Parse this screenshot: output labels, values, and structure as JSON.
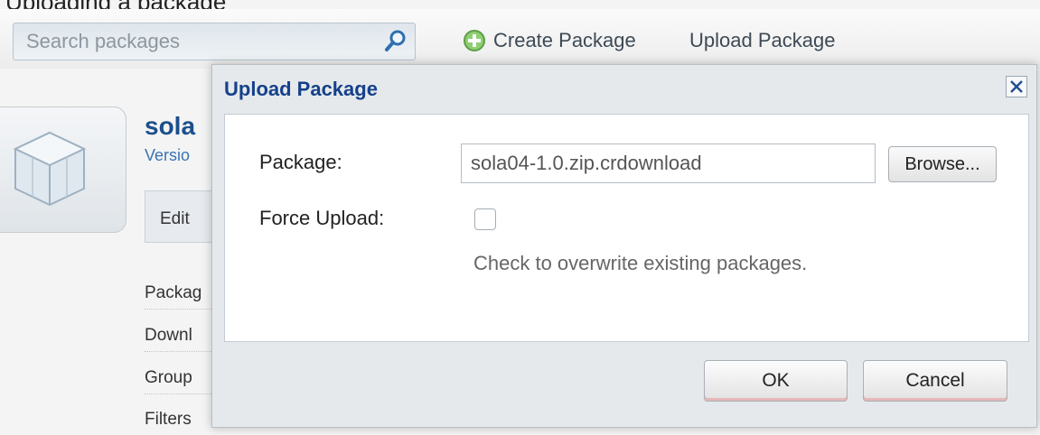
{
  "caption": "Uploading a package",
  "toolbar": {
    "search_placeholder": "Search packages",
    "search_icon": "magnifier-icon",
    "create_label": "Create Package",
    "create_icon": "green-plus-circle-icon",
    "upload_label": "Upload Package"
  },
  "background_page": {
    "package_title": "sola",
    "version_label": "Versio",
    "edit_label": "Edit",
    "list_items": [
      "Packag",
      "Downl",
      "Group",
      "Filters"
    ]
  },
  "dialog": {
    "title": "Upload Package",
    "package_label": "Package:",
    "package_value": "sola04-1.0.zip.crdownload",
    "browse_label": "Browse...",
    "force_label": "Force Upload:",
    "force_checked": false,
    "hint": "Check to overwrite existing packages.",
    "ok_label": "OK",
    "cancel_label": "Cancel"
  },
  "colors": {
    "dialog_title": "#15418a",
    "link": "#1b4f8c",
    "button_accent": "#e6b7b7"
  }
}
